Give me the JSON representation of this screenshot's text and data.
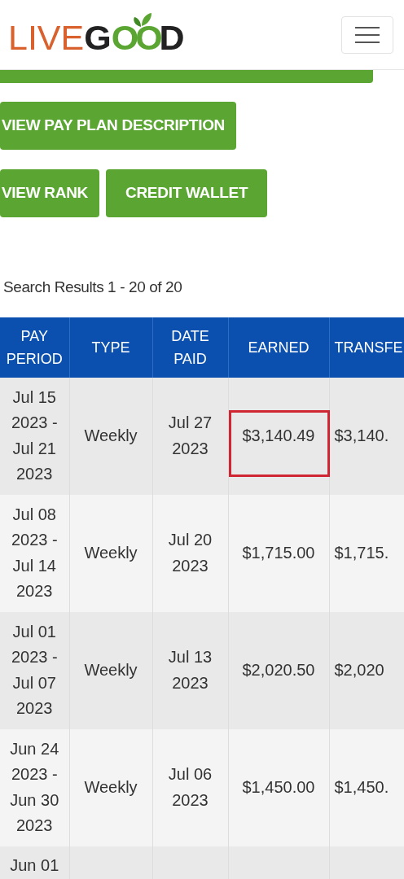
{
  "logo": {
    "light": "LIVE",
    "dark": "G",
    "green": "OO",
    "end": "D"
  },
  "buttons": [
    {
      "label": "VIEW PAY PLAN DESCRIPTION"
    },
    {
      "label": "VIEW RANK"
    },
    {
      "label": "CREDIT WALLET"
    }
  ],
  "results_summary": "Search Results 1 - 20 of 20",
  "table": {
    "columns": [
      "PAY PERIOD",
      "TYPE",
      "DATE PAID",
      "EARNED",
      "TRANSFE"
    ],
    "rows": [
      {
        "pay_period": "Jul 15 2023 - Jul 21 2023",
        "type": "Weekly",
        "date_paid": "Jul 27 2023",
        "earned": "$3,140.49",
        "transferred": "$3,140.",
        "highlighted": true
      },
      {
        "pay_period": "Jul 08 2023 - Jul 14 2023",
        "type": "Weekly",
        "date_paid": "Jul 20 2023",
        "earned": "$1,715.00",
        "transferred": "$1,715.",
        "highlighted": false
      },
      {
        "pay_period": "Jul 01 2023 - Jul 07 2023",
        "type": "Weekly",
        "date_paid": "Jul 13 2023",
        "earned": "$2,020.50",
        "transferred": "$2,020",
        "highlighted": false
      },
      {
        "pay_period": "Jun 24 2023 - Jun 30 2023",
        "type": "Weekly",
        "date_paid": "Jul 06 2023",
        "earned": "$1,450.00",
        "transferred": "$1,450.",
        "highlighted": false
      },
      {
        "pay_period": "Jun 01",
        "highlighted": false
      }
    ]
  }
}
